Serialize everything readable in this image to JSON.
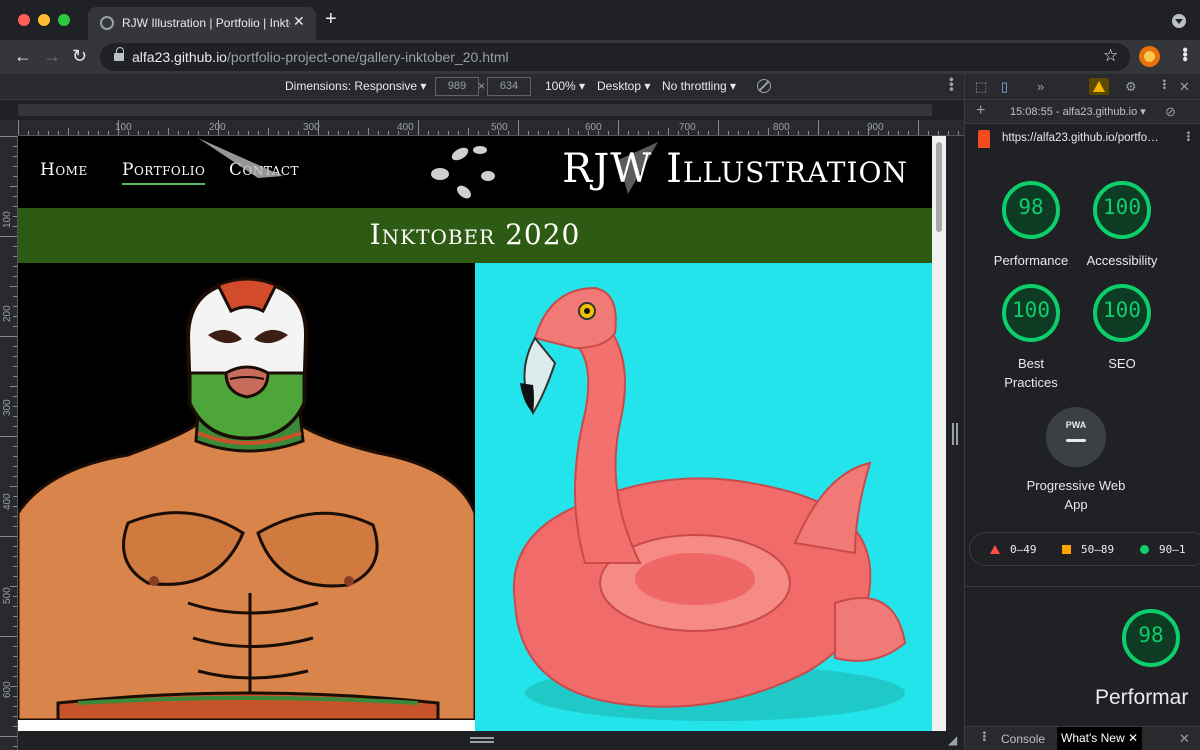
{
  "browser": {
    "tab_title": "RJW Illustration | Portfolio | Inktober",
    "tab_close": "✕",
    "new_tab": "+",
    "url_host": "alfa23.github.io",
    "url_path": "/portfolio-project-one/gallery-inktober_20.html",
    "back": "←",
    "forward": "→",
    "reload": "↻",
    "bookmark_star": "☆"
  },
  "device_toolbar": {
    "dimensions": "Dimensions: Responsive ▾",
    "width": "989",
    "x": "×",
    "height": "634",
    "zoom": "100% ▾",
    "device": "Desktop ▾",
    "throttling": "No throttling ▾"
  },
  "rulers": {
    "h_ticks": [
      "100",
      "200",
      "300",
      "400",
      "500",
      "600",
      "700",
      "800",
      "900"
    ],
    "v_ticks": [
      "100",
      "200",
      "300",
      "400",
      "500",
      "600"
    ]
  },
  "site": {
    "nav": [
      "Home",
      "Portfolio",
      "Contact"
    ],
    "brand": "RJW Illustration",
    "page_title": "Inktober 2020"
  },
  "devtools": {
    "more_tabs": "»",
    "session": "15:08:55 - alfa23.github.io ▾",
    "report_url": "https://alfa23.github.io/portfo…",
    "scores": [
      {
        "label": "Performance",
        "value": "98"
      },
      {
        "label": "Accessibility",
        "value": "100"
      },
      {
        "label": "Best Practices",
        "value": "100"
      },
      {
        "label": "SEO",
        "value": "100"
      }
    ],
    "pwa_badge": "PWA",
    "pwa_label": "Progressive Web App",
    "legend": [
      "0–49",
      "50–89",
      "90–1"
    ],
    "perf_score": "98",
    "perf_heading": "Performar",
    "drawer_tabs": [
      "Console",
      "What's New"
    ]
  },
  "colors": {
    "score_green": "#0cce6b",
    "title_band": "#2e5b13",
    "flamingo_bg": "#23e4ea"
  }
}
